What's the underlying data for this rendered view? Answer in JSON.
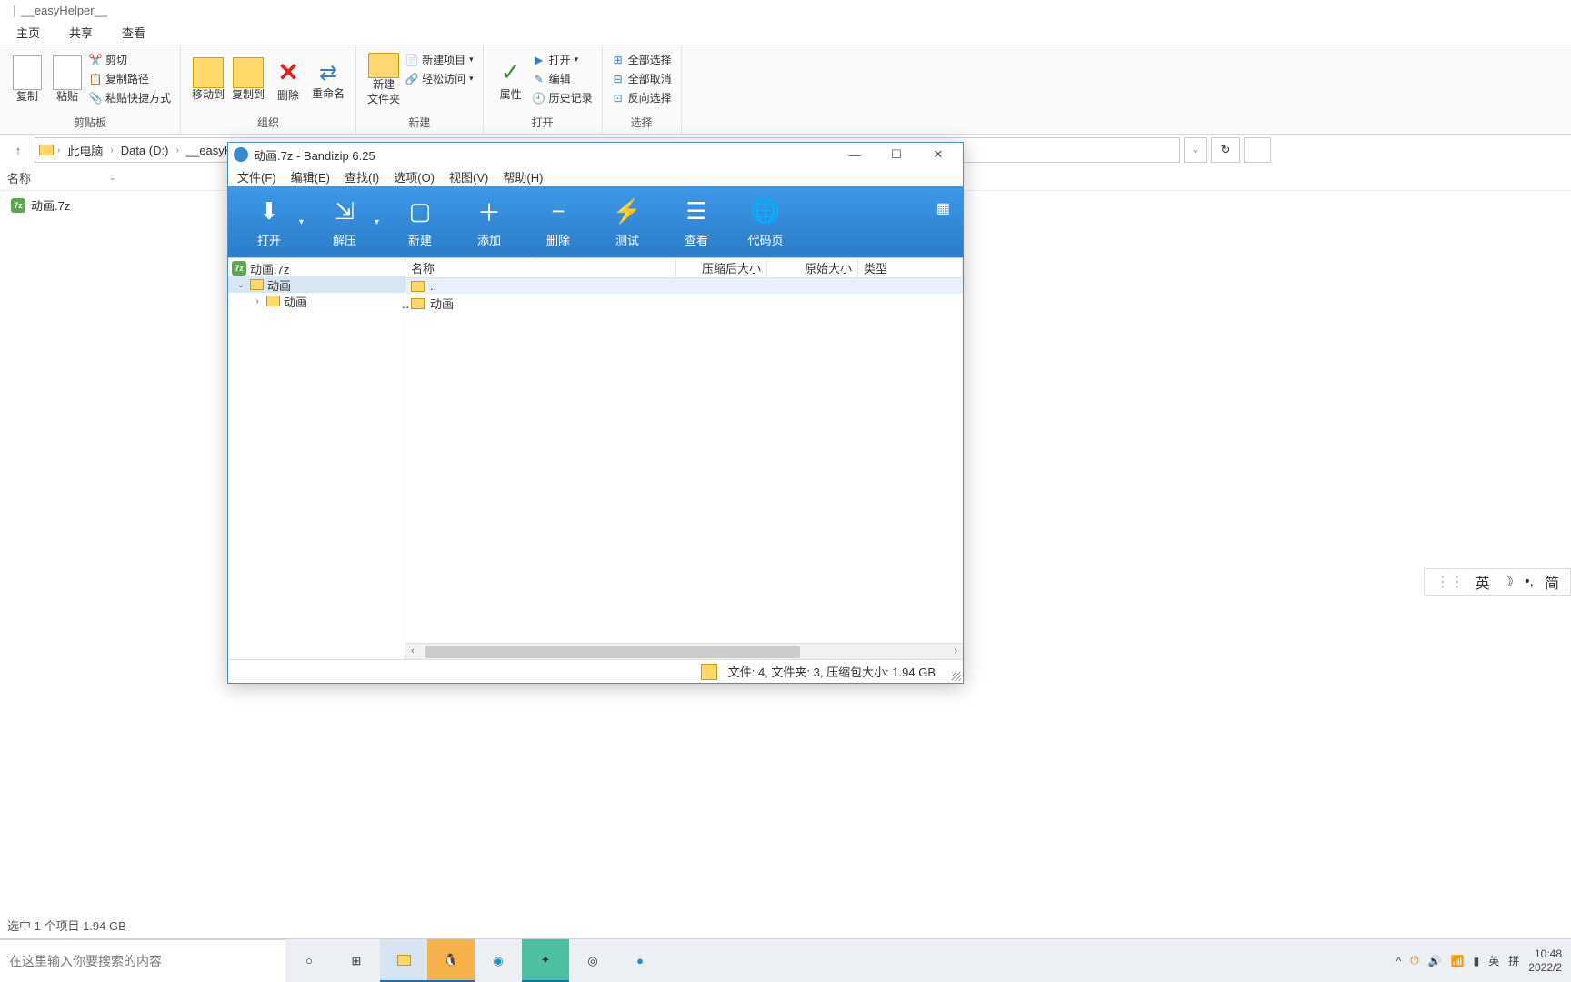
{
  "explorer": {
    "title_path": "__easyHelper__",
    "tabs": [
      "主页",
      "共享",
      "查看"
    ],
    "ribbon": {
      "groups": {
        "clipboard": {
          "label": "剪贴板",
          "copy": "复制",
          "paste": "粘贴",
          "cut": "剪切",
          "copy_path": "复制路径",
          "paste_shortcut": "粘贴快捷方式"
        },
        "organize": {
          "label": "组织",
          "move_to": "移动到",
          "copy_to": "复制到",
          "delete": "删除",
          "rename": "重命名"
        },
        "new": {
          "label": "新建",
          "new_folder": "新建\n文件夹",
          "new_item": "新建项目",
          "easy_access": "轻松访问"
        },
        "open": {
          "label": "打开",
          "properties": "属性",
          "open": "打开",
          "edit": "编辑",
          "history": "历史记录"
        },
        "select": {
          "label": "选择",
          "select_all": "全部选择",
          "select_none": "全部取消",
          "invert": "反向选择"
        }
      }
    },
    "breadcrumb": [
      "此电脑",
      "Data (D:)",
      "__easyHe"
    ],
    "columns": {
      "name": "名称"
    },
    "files": [
      {
        "name": "动画.7z"
      }
    ],
    "status": "选中 1 个项目  1.94 GB"
  },
  "bandizip": {
    "title": "动画.7z - Bandizip 6.25",
    "menu": [
      "文件(F)",
      "编辑(E)",
      "查找(I)",
      "选项(O)",
      "视图(V)",
      "帮助(H)"
    ],
    "toolbar": [
      "打开",
      "解压",
      "新建",
      "添加",
      "删除",
      "测试",
      "查看",
      "代码页"
    ],
    "tree": {
      "root": "动画.7z",
      "l1": "动画",
      "l2": "动画"
    },
    "columns": {
      "name": "名称",
      "packed": "压缩后大小",
      "orig": "原始大小",
      "type": "类型"
    },
    "rows": [
      {
        "name": ".."
      },
      {
        "name": "动画"
      }
    ],
    "status": "文件: 4, 文件夹: 3, 压缩包大小: 1.94 GB"
  },
  "ime": {
    "lang": "英",
    "mode": "简"
  },
  "taskbar": {
    "search_placeholder": "在这里输入你要搜索的内容",
    "time": "10:48",
    "date": "2022/2",
    "lang1": "英",
    "lang2": "拼"
  }
}
